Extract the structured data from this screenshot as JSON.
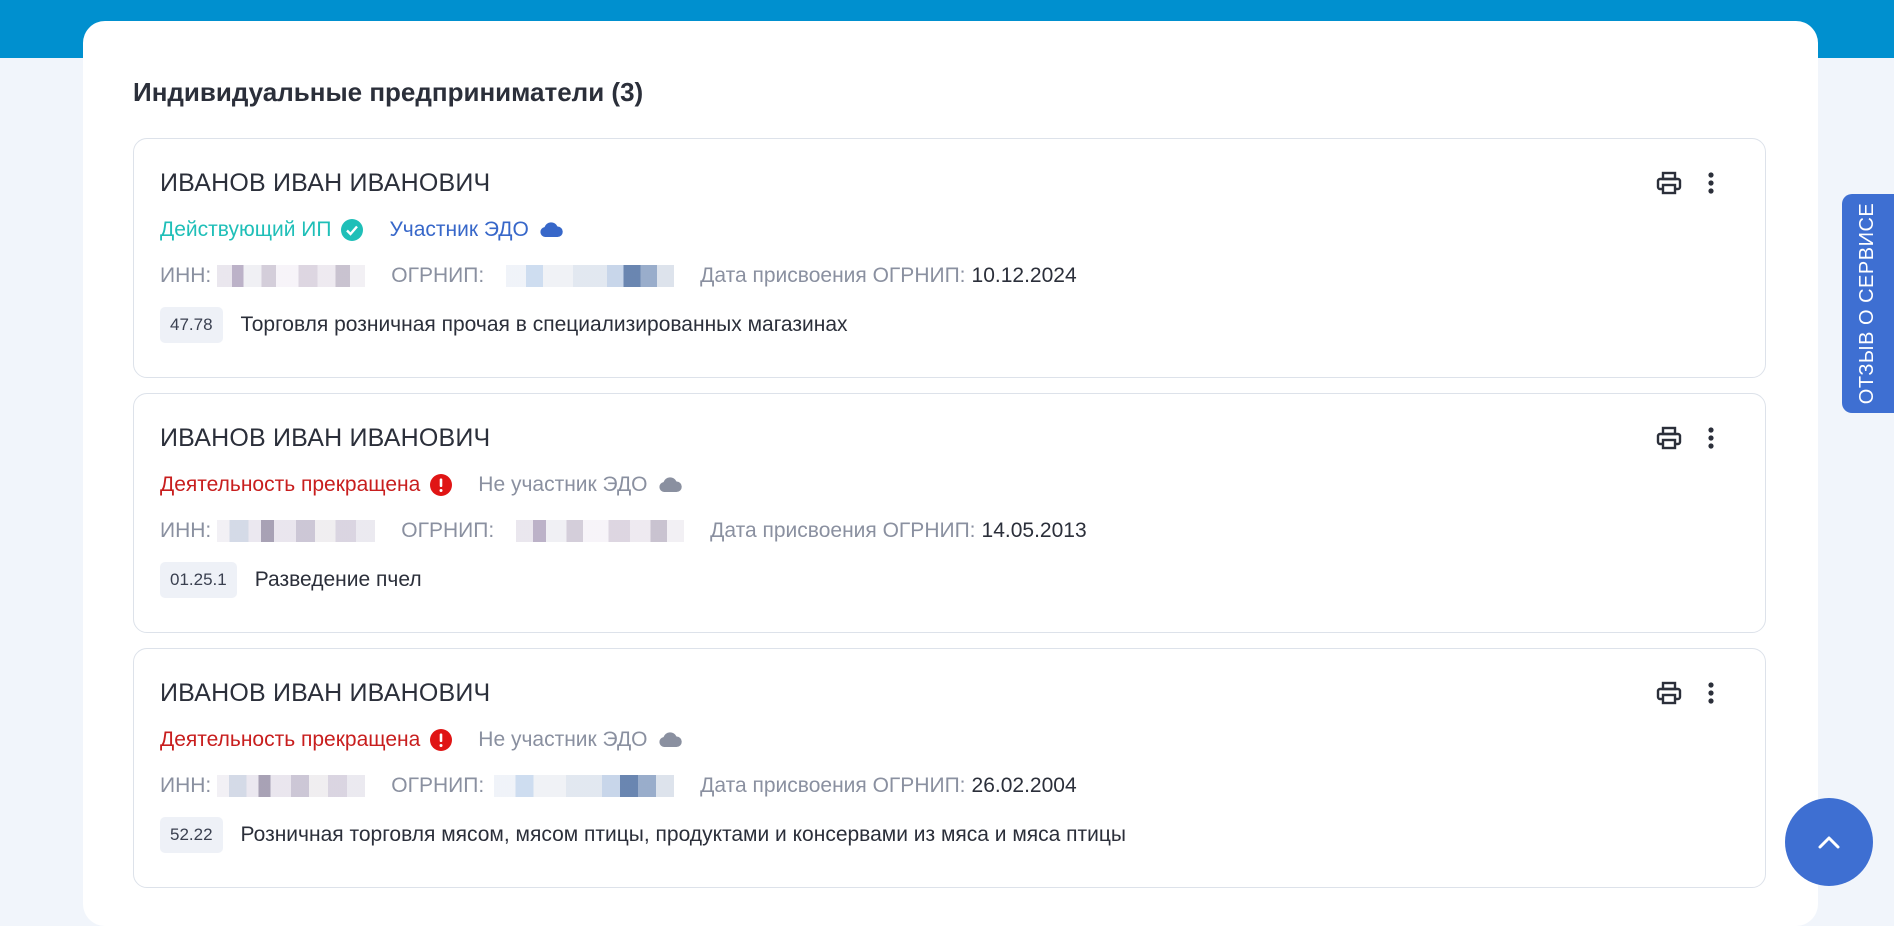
{
  "section": {
    "title": "Индивидуальные предприниматели (3)"
  },
  "colors": {
    "active_status": "#1fbfb8",
    "edo_participant": "#3767c9",
    "stopped_status": "#c81e1e",
    "muted": "#8a90a0",
    "accent": "#3e6fd2",
    "header_band": "#0090cf"
  },
  "cards": [
    {
      "name": "ИВАНОВ ИВАН ИВАНОВИЧ",
      "status": {
        "label": "Действующий ИП",
        "icon": "check-circle-icon",
        "kind": "active"
      },
      "edo": {
        "label": "Участник ЭДО",
        "icon": "cloud-icon",
        "kind": "participant"
      },
      "inn_label": "ИНН:",
      "ogrnip_label": "ОГРНИП:",
      "date_label": "Дата присвоения ОГРНИП:",
      "date_value": "10.12.2024",
      "okved_code": "47.78",
      "okved_text": "Торговля розничная прочая в специализированных магазинах"
    },
    {
      "name": "ИВАНОВ ИВАН ИВАНОВИЧ",
      "status": {
        "label": "Деятельность прекращена",
        "icon": "exclamation-circle-icon",
        "kind": "stopped"
      },
      "edo": {
        "label": "Не участник ЭДО",
        "icon": "cloud-icon",
        "kind": "non-participant"
      },
      "inn_label": "ИНН:",
      "ogrnip_label": "ОГРНИП:",
      "date_label": "Дата присвоения ОГРНИП:",
      "date_value": "14.05.2013",
      "okved_code": "01.25.1",
      "okved_text": "Разведение пчел"
    },
    {
      "name": "ИВАНОВ ИВАН ИВАНОВИЧ",
      "status": {
        "label": "Деятельность прекращена",
        "icon": "exclamation-circle-icon",
        "kind": "stopped"
      },
      "edo": {
        "label": "Не участник ЭДО",
        "icon": "cloud-icon",
        "kind": "non-participant"
      },
      "inn_label": "ИНН:",
      "ogrnip_label": "ОГРНИП:",
      "date_label": "Дата присвоения ОГРНИП:",
      "date_value": "26.02.2004",
      "okved_code": "52.22",
      "okved_text": "Розничная торговля мясом, мясом птицы, продуктами и консервами из мяса и мяса птицы"
    }
  ],
  "actions": {
    "print_icon": "printer-icon",
    "menu_icon": "more-vertical-icon"
  },
  "feedback_tab": {
    "label": "ОТЗЫВ О СЕРВИСЕ"
  },
  "scroll_top": {
    "icon": "chevron-up-icon"
  }
}
